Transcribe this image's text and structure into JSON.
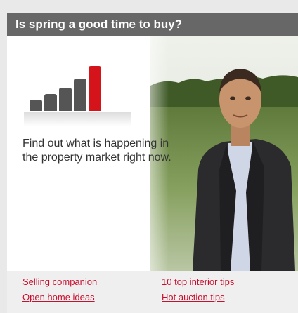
{
  "widget": {
    "title": "Is spring a good time to buy?",
    "description": "Find out what is happening in the property market right now.",
    "bar_levels": [
      0.25,
      0.38,
      0.52,
      0.72,
      1.0
    ],
    "bar_colors": [
      "#555555",
      "#555555",
      "#555555",
      "#555555",
      "#d4131b"
    ],
    "video_icon": "presenter-video-thumbnail",
    "links": [
      "Selling companion",
      "10 top interior tips",
      "Open home ideas",
      "Hot auction tips"
    ]
  },
  "colors": {
    "header_bg": "#676767",
    "link": "#c8102e",
    "accent": "#d4131b"
  }
}
